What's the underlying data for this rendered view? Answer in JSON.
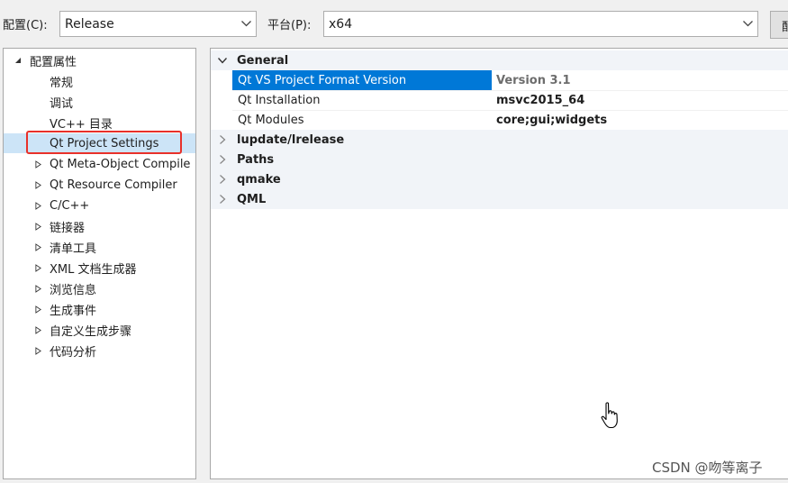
{
  "toolbar": {
    "config_label": "配置(C):",
    "config_value": "Release",
    "platform_label": "平台(P):",
    "platform_value": "x64",
    "edge_button_label": "配"
  },
  "tree": {
    "root": "配置属性",
    "items": [
      {
        "label": "常规",
        "expandable": false,
        "selected": false
      },
      {
        "label": "调试",
        "expandable": false,
        "selected": false
      },
      {
        "label": "VC++ 目录",
        "expandable": false,
        "selected": false
      },
      {
        "label": "Qt Project Settings",
        "expandable": false,
        "selected": true
      },
      {
        "label": "Qt Meta-Object Compile",
        "expandable": true,
        "selected": false
      },
      {
        "label": "Qt Resource Compiler",
        "expandable": true,
        "selected": false
      },
      {
        "label": "C/C++",
        "expandable": true,
        "selected": false
      },
      {
        "label": "链接器",
        "expandable": true,
        "selected": false
      },
      {
        "label": "清单工具",
        "expandable": true,
        "selected": false
      },
      {
        "label": "XML 文档生成器",
        "expandable": true,
        "selected": false
      },
      {
        "label": "浏览信息",
        "expandable": true,
        "selected": false
      },
      {
        "label": "生成事件",
        "expandable": true,
        "selected": false
      },
      {
        "label": "自定义生成步骤",
        "expandable": true,
        "selected": false
      },
      {
        "label": "代码分析",
        "expandable": true,
        "selected": false
      }
    ]
  },
  "grid": {
    "general": {
      "label": "General",
      "props": [
        {
          "name": "Qt VS Project Format Version",
          "value": "Version 3.1"
        },
        {
          "name": "Qt Installation",
          "value": "msvc2015_64"
        },
        {
          "name": "Qt Modules",
          "value": "core;gui;widgets"
        }
      ]
    },
    "categories": [
      "lupdate/lrelease",
      "Paths",
      "qmake",
      "QML"
    ]
  },
  "watermark": "CSDN @吻等离子",
  "colors": {
    "selection": "#0078d7",
    "tree_selection": "#cce4f7",
    "highlight_box": "#e8312a"
  }
}
